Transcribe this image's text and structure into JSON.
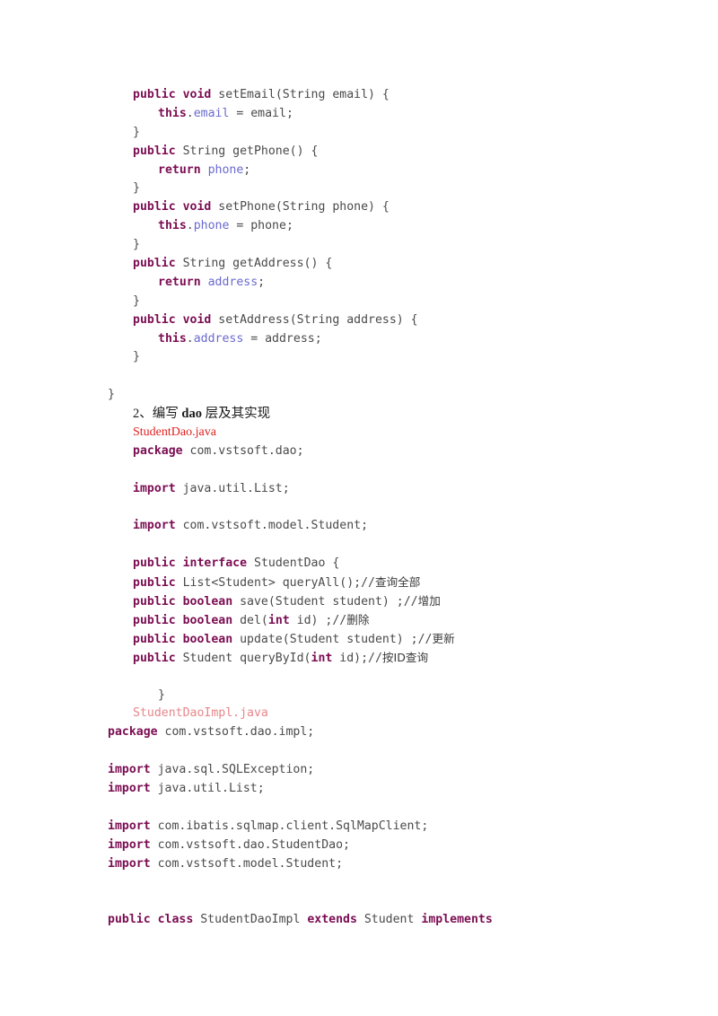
{
  "document": {
    "type": "java-source-listing",
    "page_background": "#ffffff",
    "colors": {
      "keyword": "#7b0d52",
      "field": "#6a6ad0",
      "code_default": "#3b3b3b",
      "red_heading_file": "#e02020",
      "red_mono_file": "#e8868b",
      "prose": "#1a1a1a"
    },
    "lines": [
      {
        "id": "l01",
        "indent": 1,
        "kind": "code",
        "tokens": [
          {
            "t": "public",
            "c": "kw"
          },
          {
            "t": " ",
            "c": "plain"
          },
          {
            "t": "void",
            "c": "kw"
          },
          {
            "t": " setEmail(String email) {",
            "c": "plain"
          }
        ]
      },
      {
        "id": "l02",
        "indent": 2,
        "kind": "code",
        "tokens": [
          {
            "t": "this",
            "c": "kw"
          },
          {
            "t": ".",
            "c": "plain"
          },
          {
            "t": "email",
            "c": "fld"
          },
          {
            "t": " = email;",
            "c": "plain"
          }
        ]
      },
      {
        "id": "l03",
        "indent": 1,
        "kind": "code",
        "tokens": [
          {
            "t": "}",
            "c": "plain"
          }
        ]
      },
      {
        "id": "l04",
        "indent": 1,
        "kind": "code",
        "tokens": [
          {
            "t": "public",
            "c": "kw"
          },
          {
            "t": " String getPhone() {",
            "c": "plain"
          }
        ]
      },
      {
        "id": "l05",
        "indent": 2,
        "kind": "code",
        "tokens": [
          {
            "t": "return",
            "c": "kw"
          },
          {
            "t": " ",
            "c": "plain"
          },
          {
            "t": "phone",
            "c": "fld"
          },
          {
            "t": ";",
            "c": "plain"
          }
        ]
      },
      {
        "id": "l06",
        "indent": 1,
        "kind": "code",
        "tokens": [
          {
            "t": "}",
            "c": "plain"
          }
        ]
      },
      {
        "id": "l07",
        "indent": 1,
        "kind": "code",
        "tokens": [
          {
            "t": "public",
            "c": "kw"
          },
          {
            "t": " ",
            "c": "plain"
          },
          {
            "t": "void",
            "c": "kw"
          },
          {
            "t": " setPhone(String phone) {",
            "c": "plain"
          }
        ]
      },
      {
        "id": "l08",
        "indent": 2,
        "kind": "code",
        "tokens": [
          {
            "t": "this",
            "c": "kw"
          },
          {
            "t": ".",
            "c": "plain"
          },
          {
            "t": "phone",
            "c": "fld"
          },
          {
            "t": " = phone;",
            "c": "plain"
          }
        ]
      },
      {
        "id": "l09",
        "indent": 1,
        "kind": "code",
        "tokens": [
          {
            "t": "}",
            "c": "plain"
          }
        ]
      },
      {
        "id": "l10",
        "indent": 1,
        "kind": "code",
        "tokens": [
          {
            "t": "public",
            "c": "kw"
          },
          {
            "t": " String getAddress() {",
            "c": "plain"
          }
        ]
      },
      {
        "id": "l11",
        "indent": 2,
        "kind": "code",
        "tokens": [
          {
            "t": "return",
            "c": "kw"
          },
          {
            "t": " ",
            "c": "plain"
          },
          {
            "t": "address",
            "c": "fld"
          },
          {
            "t": ";",
            "c": "plain"
          }
        ]
      },
      {
        "id": "l12",
        "indent": 1,
        "kind": "code",
        "tokens": [
          {
            "t": "}",
            "c": "plain"
          }
        ]
      },
      {
        "id": "l13",
        "indent": 1,
        "kind": "code",
        "tokens": [
          {
            "t": "public",
            "c": "kw"
          },
          {
            "t": " ",
            "c": "plain"
          },
          {
            "t": "void",
            "c": "kw"
          },
          {
            "t": " setAddress(String address) {",
            "c": "plain"
          }
        ]
      },
      {
        "id": "l14",
        "indent": 2,
        "kind": "code",
        "tokens": [
          {
            "t": "this",
            "c": "kw"
          },
          {
            "t": ".",
            "c": "plain"
          },
          {
            "t": "address",
            "c": "fld"
          },
          {
            "t": " = address;",
            "c": "plain"
          }
        ]
      },
      {
        "id": "l15",
        "indent": 1,
        "kind": "code",
        "tokens": [
          {
            "t": "}",
            "c": "plain"
          }
        ]
      },
      {
        "id": "l16",
        "indent": 0,
        "kind": "blank",
        "tokens": []
      },
      {
        "id": "l17",
        "indent": 0,
        "kind": "code",
        "tokens": [
          {
            "t": "}",
            "c": "plain"
          }
        ]
      },
      {
        "id": "l18",
        "indent": 1,
        "kind": "prose",
        "text": "2、编写 dao 层及其实现",
        "bold_parts": [
          "dao"
        ]
      },
      {
        "id": "l19",
        "indent": 1,
        "kind": "prose-red",
        "text": "StudentDao.java"
      },
      {
        "id": "l20",
        "indent": 1,
        "kind": "code",
        "tokens": [
          {
            "t": "package",
            "c": "kw"
          },
          {
            "t": " com.vstsoft.dao;",
            "c": "plain"
          }
        ]
      },
      {
        "id": "l21",
        "indent": 0,
        "kind": "blank",
        "tokens": []
      },
      {
        "id": "l22",
        "indent": 1,
        "kind": "code",
        "tokens": [
          {
            "t": "import",
            "c": "kw"
          },
          {
            "t": " java.util.List;",
            "c": "plain"
          }
        ]
      },
      {
        "id": "l23",
        "indent": 0,
        "kind": "blank",
        "tokens": []
      },
      {
        "id": "l24",
        "indent": 1,
        "kind": "code",
        "tokens": [
          {
            "t": "import",
            "c": "kw"
          },
          {
            "t": " com.vstsoft.model.Student;",
            "c": "plain"
          }
        ]
      },
      {
        "id": "l25",
        "indent": 0,
        "kind": "blank",
        "tokens": []
      },
      {
        "id": "l26",
        "indent": 1,
        "kind": "code",
        "tokens": [
          {
            "t": "public",
            "c": "kw"
          },
          {
            "t": " ",
            "c": "plain"
          },
          {
            "t": "interface",
            "c": "kw"
          },
          {
            "t": " StudentDao {",
            "c": "plain"
          }
        ]
      },
      {
        "id": "l27",
        "indent": 1,
        "kind": "code",
        "tokens": [
          {
            "t": "public",
            "c": "kw"
          },
          {
            "t": " List<Student> queryAll();//",
            "c": "plain"
          },
          {
            "t": "查询全部",
            "c": "cjk"
          }
        ]
      },
      {
        "id": "l28",
        "indent": 1,
        "kind": "code",
        "tokens": [
          {
            "t": "public",
            "c": "kw"
          },
          {
            "t": " ",
            "c": "plain"
          },
          {
            "t": "boolean",
            "c": "kw"
          },
          {
            "t": " save(Student student) ;//",
            "c": "plain"
          },
          {
            "t": "增加",
            "c": "cjk"
          }
        ]
      },
      {
        "id": "l29",
        "indent": 1,
        "kind": "code",
        "tokens": [
          {
            "t": "public",
            "c": "kw"
          },
          {
            "t": " ",
            "c": "plain"
          },
          {
            "t": "boolean",
            "c": "kw"
          },
          {
            "t": " del(",
            "c": "plain"
          },
          {
            "t": "int",
            "c": "kw"
          },
          {
            "t": " id) ;//",
            "c": "plain"
          },
          {
            "t": "删除",
            "c": "cjk"
          }
        ]
      },
      {
        "id": "l30",
        "indent": 1,
        "kind": "code",
        "tokens": [
          {
            "t": "public",
            "c": "kw"
          },
          {
            "t": " ",
            "c": "plain"
          },
          {
            "t": "boolean",
            "c": "kw"
          },
          {
            "t": " update(Student student) ;//",
            "c": "plain"
          },
          {
            "t": "更新",
            "c": "cjk"
          }
        ]
      },
      {
        "id": "l31",
        "indent": 1,
        "kind": "code",
        "tokens": [
          {
            "t": "public",
            "c": "kw"
          },
          {
            "t": " Student queryById(",
            "c": "plain"
          },
          {
            "t": "int",
            "c": "kw"
          },
          {
            "t": " id);//",
            "c": "plain"
          },
          {
            "t": "按ID查询",
            "c": "cjk"
          }
        ]
      },
      {
        "id": "l32",
        "indent": 0,
        "kind": "blank",
        "tokens": []
      },
      {
        "id": "l33",
        "indent": 2,
        "kind": "code",
        "tokens": [
          {
            "t": "}",
            "c": "plain"
          }
        ]
      },
      {
        "id": "l34",
        "indent": 1,
        "kind": "code",
        "tokens": [
          {
            "t": "StudentDaoImpl.java",
            "c": "redmono"
          }
        ]
      },
      {
        "id": "l35",
        "indent": 0,
        "kind": "code",
        "tokens": [
          {
            "t": "package",
            "c": "kw"
          },
          {
            "t": " com.vstsoft.dao.impl;",
            "c": "plain"
          }
        ]
      },
      {
        "id": "l36",
        "indent": 0,
        "kind": "blank",
        "tokens": []
      },
      {
        "id": "l37",
        "indent": 0,
        "kind": "code",
        "tokens": [
          {
            "t": "import",
            "c": "kw"
          },
          {
            "t": " java.sql.SQLException;",
            "c": "plain"
          }
        ]
      },
      {
        "id": "l38",
        "indent": 0,
        "kind": "code",
        "tokens": [
          {
            "t": "import",
            "c": "kw"
          },
          {
            "t": " java.util.List;",
            "c": "plain"
          }
        ]
      },
      {
        "id": "l39",
        "indent": 0,
        "kind": "blank",
        "tokens": []
      },
      {
        "id": "l40",
        "indent": 0,
        "kind": "code",
        "tokens": [
          {
            "t": "import",
            "c": "kw"
          },
          {
            "t": " com.ibatis.sqlmap.client.SqlMapClient;",
            "c": "plain"
          }
        ]
      },
      {
        "id": "l41",
        "indent": 0,
        "kind": "code",
        "tokens": [
          {
            "t": "import",
            "c": "kw"
          },
          {
            "t": " com.vstsoft.dao.StudentDao;",
            "c": "plain"
          }
        ]
      },
      {
        "id": "l42",
        "indent": 0,
        "kind": "code",
        "tokens": [
          {
            "t": "import",
            "c": "kw"
          },
          {
            "t": " com.vstsoft.model.Student;",
            "c": "plain"
          }
        ]
      },
      {
        "id": "l43",
        "indent": 0,
        "kind": "blank",
        "tokens": []
      },
      {
        "id": "l44",
        "indent": 0,
        "kind": "blank",
        "tokens": []
      },
      {
        "id": "l45",
        "indent": 0,
        "kind": "code",
        "tokens": [
          {
            "t": "public",
            "c": "kw"
          },
          {
            "t": " ",
            "c": "plain"
          },
          {
            "t": "class",
            "c": "kw"
          },
          {
            "t": " StudentDaoImpl ",
            "c": "plain"
          },
          {
            "t": "extends",
            "c": "kw"
          },
          {
            "t": " Student ",
            "c": "plain"
          },
          {
            "t": "implements",
            "c": "kw"
          }
        ]
      }
    ]
  }
}
